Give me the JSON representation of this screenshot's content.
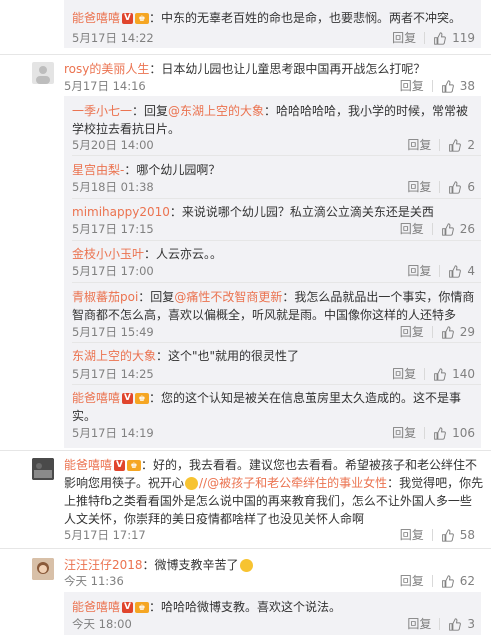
{
  "reply_action": "回复",
  "badges": {
    "v": "V",
    "lv": "♚"
  },
  "items": [
    {
      "id": "r0",
      "user": "能爸嘻嘻",
      "badges": true,
      "mention": "",
      "text": "：中东的无辜老百姓的命也是命，也要悲悯。两者不冲突。",
      "time": "5月17日 14:22",
      "likes": "119"
    },
    {
      "id": "c1",
      "user": "rosy的美丽人生",
      "badges": false,
      "text": "：日本幼儿园也让儿童思考跟中国再开战怎么打呢？",
      "time": "5月17日 14:16",
      "likes": "38"
    },
    {
      "id": "r1",
      "user": "一季小七一",
      "mention": "@东湖上空的大象",
      "text_prefix": "：回复",
      "text": "：哈哈哈哈哈，我小学的时候，常常被",
      "text2": "学校拉去看抗日片。",
      "time": "5月20日 14:00",
      "likes": "2"
    },
    {
      "id": "r2",
      "user": "星宫由梨-",
      "text": "：哪个幼儿园啊？",
      "time": "5月18日 01:38",
      "likes": "6"
    },
    {
      "id": "r3",
      "user": "mimihappy2010",
      "text": "：来说说哪个幼儿园？私立滴公立滴关东还是关西",
      "time": "5月17日 17:15",
      "likes": "26"
    },
    {
      "id": "r4",
      "user": "金枝小小玉叶",
      "text": "：人云亦云。。",
      "time": "5月17日 17:00",
      "likes": "4"
    },
    {
      "id": "r5",
      "user": "青椒蕃茄poi",
      "mention": "@痛性不改智商更新",
      "text_prefix": "：回复",
      "text": "：我怎么品就品出一个事实，你情商",
      "text2": "智商都不怎么高，喜欢以偏概全，听风就是雨。中国像你这样的人还特多",
      "time": "5月17日 15:49",
      "likes": "29"
    },
    {
      "id": "r6",
      "user": "东湖上空的大象",
      "text": "：这个\"也\"就用的很灵性了",
      "time": "5月17日 14:25",
      "likes": "140"
    },
    {
      "id": "r7",
      "user": "能爸嘻嘻",
      "badges": true,
      "text": "：您的这个认知是被关在信息茧房里太久造成的。这不是事",
      "text2": "实。",
      "time": "5月17日 14:19",
      "likes": "106"
    },
    {
      "id": "c2",
      "user": "能爸嘻嘻",
      "badges": true,
      "text": "：好的，我去看看。建议您也去看看。希望被孩子和老公绊住不",
      "text2": "影响您用筷子。祝开心",
      "mention": "//@被孩子和老公牵绊住的事业女性",
      "text3": "：我觉得吧，你先",
      "text4": "上推特fb之类看看国外是怎么说中国的再来教育我们，怎么不让外国人多一些",
      "text5": "人文关怀，你崇拜的美日疫情都啥样了也没见关怀人命啊",
      "time": "5月17日 17:17",
      "likes": "58"
    },
    {
      "id": "c3",
      "user": "汪汪汪仔2018",
      "text": "：微博支教辛苦了",
      "time": "今天 11:36",
      "likes": "62"
    },
    {
      "id": "r8",
      "user": "能爸嘻嘻",
      "badges": true,
      "text": "：哈哈哈微博支教。喜欢这个说法。",
      "time": "今天 18:00",
      "likes": "3"
    }
  ]
}
